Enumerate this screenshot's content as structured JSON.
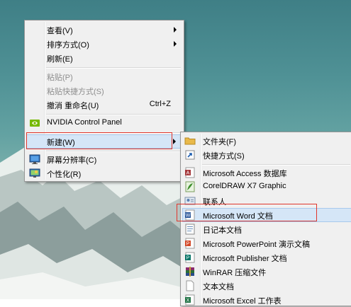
{
  "context_menu": {
    "items": [
      {
        "label": "查看(V)"
      },
      {
        "label": "排序方式(O)"
      },
      {
        "label": "刷新(E)"
      },
      {
        "label": "粘贴(P)"
      },
      {
        "label": "粘贴快捷方式(S)"
      },
      {
        "label": "撤消 重命名(U)",
        "shortcut": "Ctrl+Z"
      },
      {
        "label": "NVIDIA Control Panel"
      },
      {
        "label": "新建(W)"
      },
      {
        "label": "屏幕分辨率(C)"
      },
      {
        "label": "个性化(R)"
      }
    ]
  },
  "submenu": {
    "items": [
      {
        "label": "文件夹(F)"
      },
      {
        "label": "快捷方式(S)"
      },
      {
        "label": "Microsoft Access 数据库"
      },
      {
        "label": "CorelDRAW X7 Graphic"
      },
      {
        "label": "联系人"
      },
      {
        "label": "Microsoft Word 文档"
      },
      {
        "label": "日记本文档"
      },
      {
        "label": "Microsoft PowerPoint 演示文稿"
      },
      {
        "label": "Microsoft Publisher 文档"
      },
      {
        "label": "WinRAR 压缩文件"
      },
      {
        "label": "文本文档"
      },
      {
        "label": "Microsoft Excel 工作表"
      }
    ]
  },
  "colors": {
    "menu_bg": "#f0f0f0",
    "highlight": "#d5e6f7",
    "annotation_red": "#e0362c"
  }
}
